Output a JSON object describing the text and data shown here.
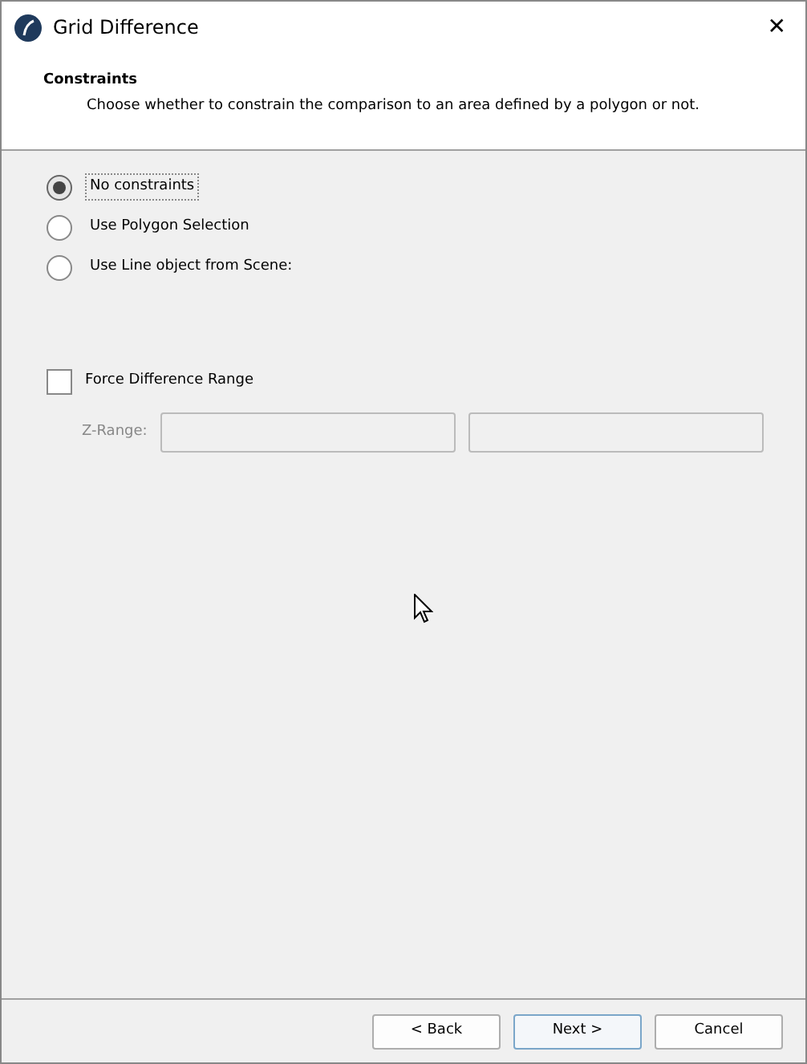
{
  "window": {
    "title": "Grid Difference",
    "close": "✕"
  },
  "header": {
    "title": "Constraints",
    "description": "Choose whether to constrain the comparison to an area defined by a polygon or not."
  },
  "options": [
    {
      "label": "No constraints",
      "selected": true,
      "focused": true
    },
    {
      "label": "Use Polygon Selection",
      "selected": false,
      "focused": false
    },
    {
      "label": "Use Line object from Scene:",
      "selected": false,
      "focused": false
    }
  ],
  "force_range": {
    "label": "Force Difference Range",
    "checked": false
  },
  "z_range": {
    "label": "Z-Range:",
    "disabled": true
  },
  "buttons": [
    {
      "label": "< Back",
      "kind": "secondary"
    },
    {
      "label": "Next >",
      "kind": "default"
    },
    {
      "label": "Cancel",
      "kind": "secondary"
    }
  ]
}
